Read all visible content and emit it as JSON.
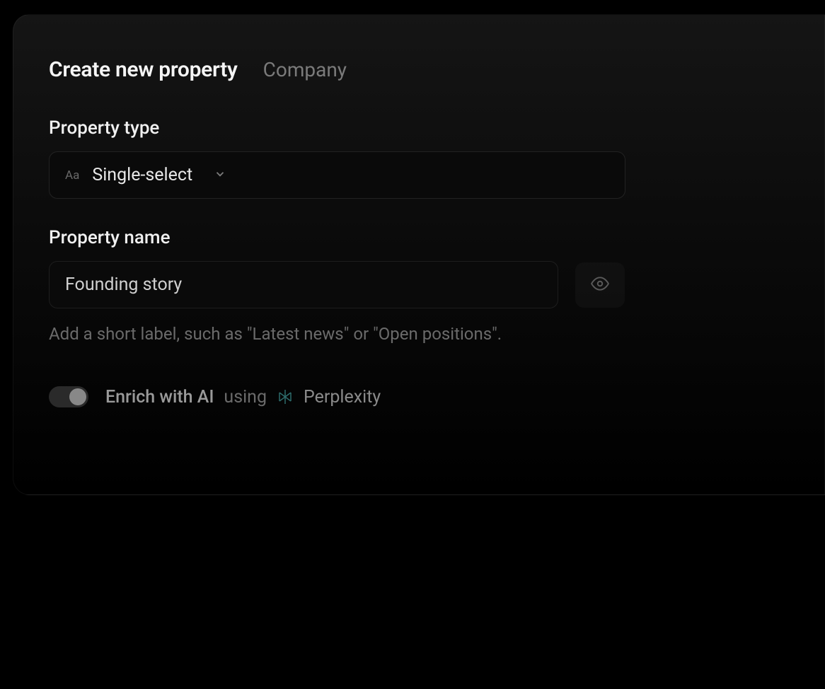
{
  "header": {
    "title": "Create new property",
    "context": "Company"
  },
  "propertyType": {
    "label": "Property type",
    "icon": "Aa",
    "value": "Single-select"
  },
  "propertyName": {
    "label": "Property name",
    "value": "Founding story",
    "helper": "Add a short label, such as \"Latest news\" or \"Open positions\"."
  },
  "enrich": {
    "label": "Enrich with AI",
    "using": "using",
    "provider": "Perplexity"
  }
}
